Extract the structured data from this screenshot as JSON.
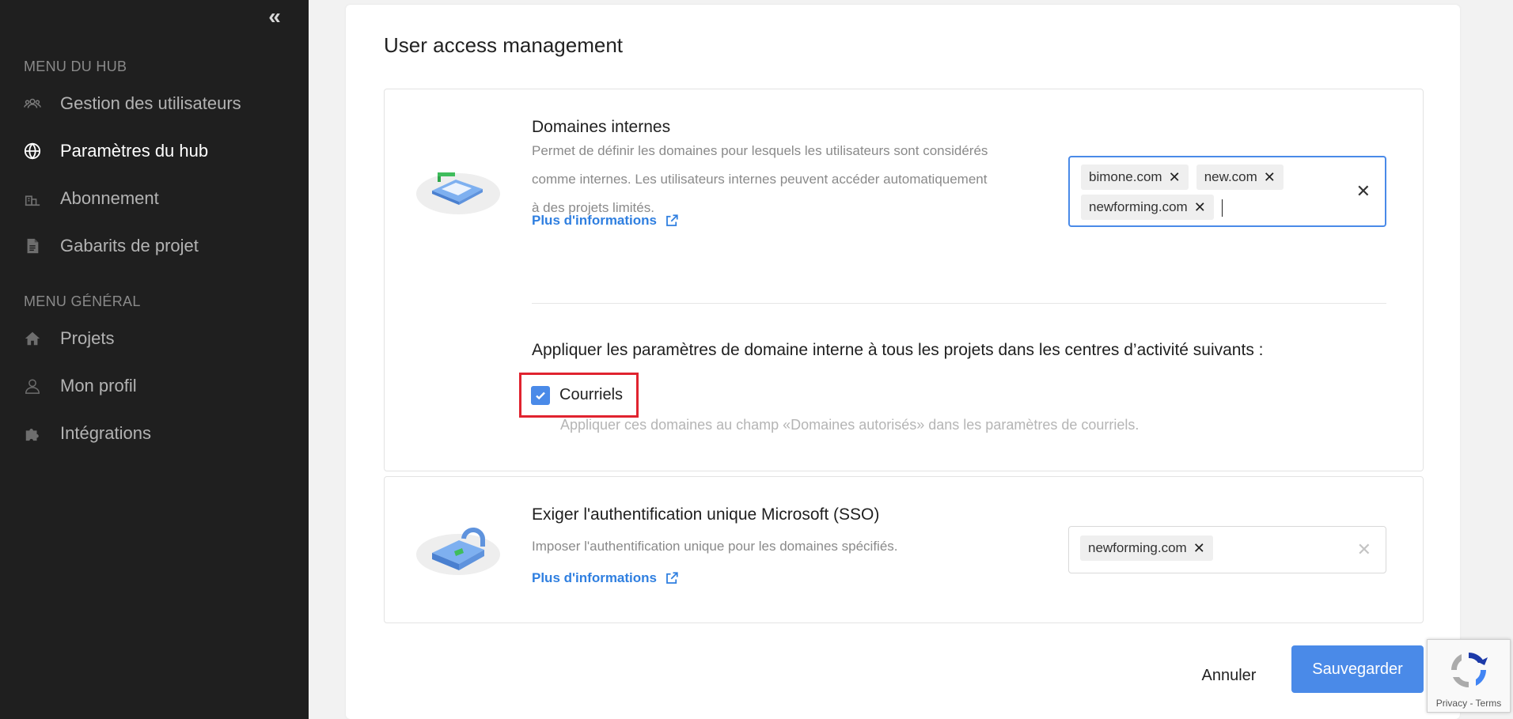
{
  "sidebar": {
    "collapse_icon": "chevrons-left-icon",
    "hub_menu_title": "MENU DU HUB",
    "hub_items": [
      {
        "label": "Gestion des utilisateurs",
        "icon": "users-icon",
        "active": false
      },
      {
        "label": "Paramètres du hub",
        "icon": "globe-icon",
        "active": true
      },
      {
        "label": "Abonnement",
        "icon": "subscription-icon",
        "active": false
      },
      {
        "label": "Gabarits de projet",
        "icon": "document-icon",
        "active": false
      }
    ],
    "general_menu_title": "MENU GÉNÉRAL",
    "general_items": [
      {
        "label": "Projets",
        "icon": "home-icon",
        "active": false
      },
      {
        "label": "Mon profil",
        "icon": "user-icon",
        "active": false
      },
      {
        "label": "Intégrations",
        "icon": "puzzle-icon",
        "active": false
      }
    ]
  },
  "main": {
    "title": "User access management",
    "internal_domains": {
      "title": "Domaines internes",
      "description_lines": [
        "Permet de définir les domaines pour lesquels les utilisateurs sont considérés",
        "comme internes. Les utilisateurs internes peuvent accéder automatiquement",
        "à des projets limités."
      ],
      "more_info": "Plus d'informations",
      "tags": [
        "bimone.com",
        "new.com",
        "newforming.com"
      ],
      "tag_remove_glyph": "✕",
      "clear_glyph": "✕",
      "apply_title": "Appliquer les paramètres de domaine interne à tous les projets dans les centres d’activité suivants :",
      "checkbox_label": "Courriels",
      "checkbox_checked": true,
      "checkbox_help": "Appliquer ces domaines au champ «Domaines autorisés» dans les paramètres de courriels."
    },
    "sso": {
      "title": "Exiger l'authentification unique Microsoft (SSO)",
      "description": "Imposer l'authentification unique pour les domaines spécifiés.",
      "more_info": "Plus d'informations",
      "tags": [
        "newforming.com"
      ],
      "tag_remove_glyph": "✕",
      "clear_glyph": "✕"
    },
    "actions": {
      "cancel": "Annuler",
      "save": "Sauvegarder"
    }
  },
  "recaptcha": {
    "links": "Privacy - Terms"
  },
  "colors": {
    "sidebar_bg": "#1f1f1f",
    "accent": "#4a8ae8",
    "link": "#2f7fe0",
    "highlight_box": "#e0232f"
  }
}
